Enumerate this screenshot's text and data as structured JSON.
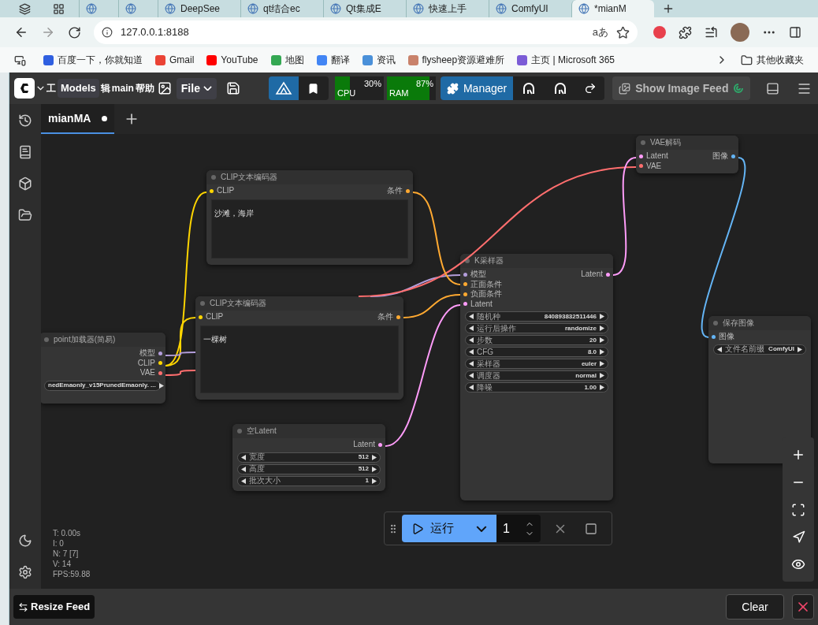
{
  "browser": {
    "tabs": [
      {
        "selected": false
      },
      {
        "selected": false
      },
      {
        "title": "DeepSee",
        "selected": false
      },
      {
        "title": "qt结合ec",
        "selected": false
      },
      {
        "title": "Qt集成E",
        "selected": false
      },
      {
        "title": "快速上手",
        "selected": false
      },
      {
        "title": "ComfyUI",
        "selected": false
      },
      {
        "title": "*mianM",
        "selected": true
      }
    ],
    "address": "127.0.0.1:8188",
    "read_aloud": "aあ",
    "bookmarks": [
      {
        "title": "百度一下，你就知道",
        "color": "#2f5fe0"
      },
      {
        "title": "Gmail",
        "color": "#ea4335"
      },
      {
        "title": "YouTube",
        "color": "#ff0000"
      },
      {
        "title": "地图",
        "color": "#34a853"
      },
      {
        "title": "翻译",
        "color": "#4285f4"
      },
      {
        "title": "资讯",
        "color": "#4a90d9"
      },
      {
        "title": "flysheep资源避难所",
        "color": "#c9826b"
      },
      {
        "title": "主页 | Microsoft 365",
        "color": "#7b5cd6"
      }
    ],
    "other_bookmarks": "其他收藏夹"
  },
  "app": {
    "menu": [
      {
        "label": "工",
        "kind": "text"
      },
      {
        "label": "Models",
        "kind": "chip"
      },
      {
        "label": "辑",
        "kind": "text"
      },
      {
        "label": "main",
        "kind": "text"
      },
      {
        "label": "帮助",
        "kind": "text"
      }
    ],
    "file_menu": "File",
    "meters": [
      {
        "label": "CPU",
        "reading": "30%",
        "level": 0.3
      },
      {
        "label": "RAM",
        "reading": "87%",
        "level": 0.87
      }
    ],
    "manager": "Manager",
    "image_feed": "Show Image Feed",
    "workflow_tabs": [
      {
        "title": "mianMA",
        "selected": true,
        "unsaved": true
      }
    ],
    "nodes": [
      {
        "title": "point加载器(简易)",
        "outputs": [
          {
            "name": "模型",
            "color": "#b39ddb"
          },
          {
            "name": "CLIP",
            "color": "#ffd500"
          },
          {
            "name": "VAE",
            "color": "#ff6e6e"
          }
        ],
        "widgets": [
          {
            "value": "nedEmaonly_v15PrunedEmaonly. ..."
          }
        ]
      },
      {
        "title": "CLIP文本编码器",
        "inputs": [
          {
            "name": "CLIP",
            "color": "#ffd500"
          }
        ],
        "outputs": [
          {
            "name": "条件",
            "color": "#ffa931"
          }
        ],
        "prompt": "沙滩，海岸"
      },
      {
        "title": "CLIP文本编码器",
        "inputs": [
          {
            "name": "CLIP",
            "color": "#ffd500"
          }
        ],
        "outputs": [
          {
            "name": "条件",
            "color": "#ffa931"
          }
        ],
        "prompt": "一棵树"
      },
      {
        "title": "K采样器",
        "inputs": [
          {
            "name": "模型",
            "color": "#b39ddb"
          },
          {
            "name": "正面条件",
            "color": "#ffa931"
          },
          {
            "name": "负面条件",
            "color": "#ffa931"
          },
          {
            "name": "Latent",
            "color": "#ff9cf9"
          }
        ],
        "outputs": [
          {
            "name": "Latent",
            "color": "#ff9cf9"
          }
        ],
        "widgets": [
          {
            "label": "随机种",
            "value": "840893832511446"
          },
          {
            "label": "运行后操作",
            "value": "randomize"
          },
          {
            "label": "步数",
            "value": "20"
          },
          {
            "label": "CFG",
            "value": "8.0"
          },
          {
            "label": "采样器",
            "value": "euler"
          },
          {
            "label": "调度器",
            "value": "normal"
          },
          {
            "label": "降噪",
            "value": "1.00"
          }
        ]
      },
      {
        "title": "VAE解码",
        "inputs": [
          {
            "name": "Latent",
            "color": "#ff9cf9"
          },
          {
            "name": "VAE",
            "color": "#ff6e6e"
          }
        ],
        "outputs": [
          {
            "name": "图像",
            "color": "#64b5f6"
          }
        ]
      },
      {
        "title": "保存图像",
        "inputs": [
          {
            "name": "图像",
            "color": "#64b5f6"
          }
        ],
        "widgets": [
          {
            "label": "文件名前缀",
            "value": "ComfyUI"
          }
        ]
      },
      {
        "title": "空Latent",
        "outputs": [
          {
            "name": "Latent",
            "color": "#ff9cf9"
          }
        ],
        "widgets": [
          {
            "label": "宽度",
            "value": "512"
          },
          {
            "label": "高度",
            "value": "512"
          },
          {
            "label": "批次大小",
            "value": "1"
          }
        ]
      }
    ],
    "stats": [
      "T: 0.00s",
      "I: 0",
      "N: 7 [7]",
      "V: 14",
      "FPS:59.88"
    ],
    "run_button": "运行",
    "batch_count": "1",
    "resize_feed": "Resize Feed",
    "clear": "Clear"
  }
}
